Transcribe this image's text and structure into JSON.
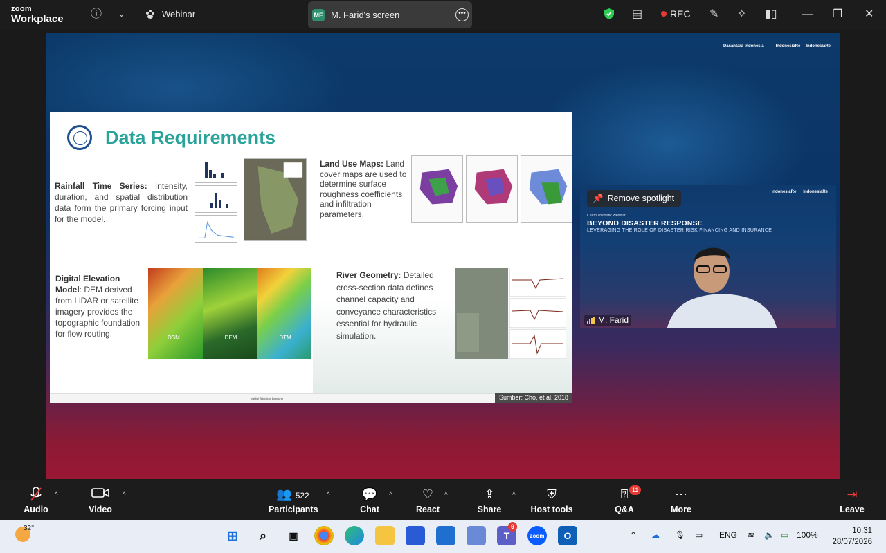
{
  "topbar": {
    "brand_line1": "zoom",
    "brand_line2": "Workplace",
    "meeting_type": "Webinar",
    "share_avatar": "MF",
    "share_label": "M. Farid's screen",
    "rec_label": "REC",
    "icons": [
      "info-icon",
      "chevron-down-icon",
      "paw-icon",
      "more-icon",
      "shield-icon",
      "notes-icon",
      "record-icon",
      "annotate-icon",
      "ai-companion-icon",
      "layout-icon",
      "minimize-icon",
      "restore-icon",
      "close-icon"
    ]
  },
  "slide": {
    "title": "Data Requirements",
    "rainfall_heading": "Rainfall Time Series:",
    "rainfall_text": " Intensity, duration, and spatial distribution data form the primary forcing input for the model.",
    "landuse_heading": "Land Use Maps:",
    "landuse_text": " Land cover maps are used to determine surface roughness coefficients and infiltration parameters.",
    "dem_heading": "Digital Elevation Model",
    "dem_text": ": DEM derived from LiDAR or satellite imagery provides the topographic foundation for flow routing.",
    "river_heading": "River Geometry:",
    "river_text": " Detailed cross-section data defines channel capacity and conveyance characteristics essential for hydraulic simulation.",
    "dem_labels": [
      "DSM",
      "DEM",
      "DTM"
    ],
    "source": "Sumber: Cho, et al. 2018",
    "footer": "Institut Teknologi Bandung",
    "stage_logos": [
      "Dasantara Indonesia",
      "IndonesiaRe",
      "IndonesiaRe"
    ]
  },
  "video": {
    "spotlight_label": "Remove spotlight",
    "webinar_title": "iLearn Thematic Webinar",
    "headline": "BEYOND DISASTER RESPONSE",
    "subline": "LEVERAGING THE ROLE OF DISASTER RISK FINANCING AND INSURANCE",
    "logos": [
      "IndonesiaRe",
      "IndonesiaRe"
    ],
    "name": "M. Farid"
  },
  "toolbar": {
    "audio": "Audio",
    "video": "Video",
    "participants": "Participants",
    "participants_count": "522",
    "chat": "Chat",
    "react": "React",
    "share": "Share",
    "host_tools": "Host tools",
    "qa": "Q&A",
    "qa_badge": "11",
    "more": "More",
    "leave": "Leave"
  },
  "taskbar": {
    "weather": "32°",
    "teams_badge": "9",
    "lang": "ENG",
    "battery": "100%",
    "time": "10.31",
    "date": "28/07/2026"
  }
}
